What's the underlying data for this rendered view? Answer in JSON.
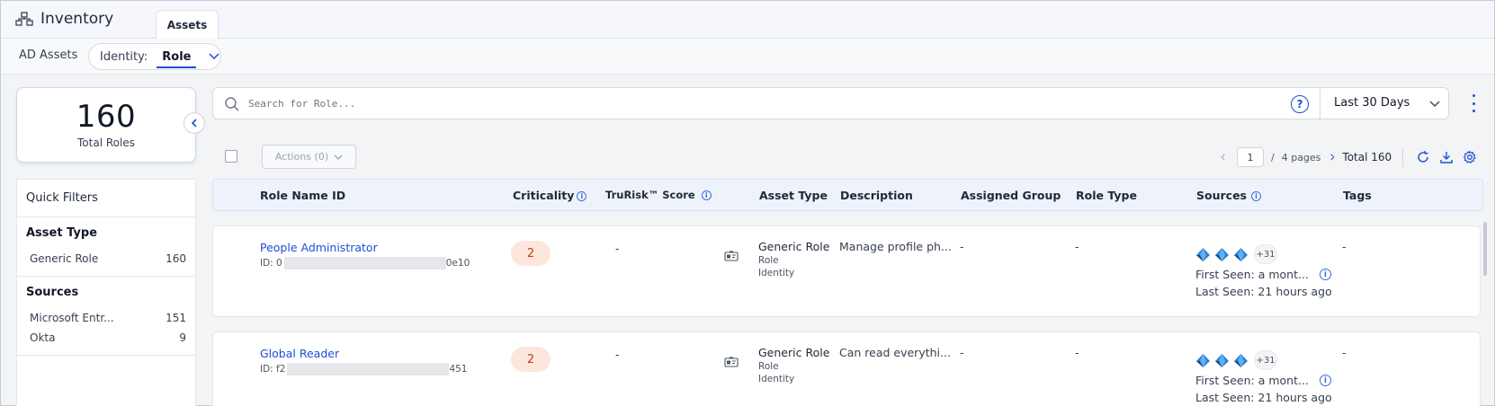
{
  "header": {
    "app_title": "Inventory",
    "tabs": [
      {
        "label": "Assets",
        "active": true
      }
    ]
  },
  "subbar": {
    "ad_assets_label": "AD Assets",
    "identity_label": "Identity:",
    "identity_value": "Role"
  },
  "summary": {
    "count": "160",
    "label": "Total Roles"
  },
  "filters": {
    "title": "Quick Filters",
    "sections": [
      {
        "title": "Asset Type",
        "items": [
          {
            "label": "Generic Role",
            "count": "160"
          }
        ]
      },
      {
        "title": "Sources",
        "items": [
          {
            "label": "Microsoft Entr...",
            "count": "151"
          },
          {
            "label": "Okta",
            "count": "9"
          }
        ]
      }
    ]
  },
  "search": {
    "placeholder": "Search for Role...",
    "help_icon": "?",
    "date_range": "Last 30 Days"
  },
  "toolbar": {
    "actions_label": "Actions (0)",
    "page_current": "1",
    "page_sep": "/",
    "page_total": "4 pages",
    "total_label": "Total 160"
  },
  "table": {
    "columns": [
      {
        "label": "Role Name ID",
        "info": false
      },
      {
        "label": "Criticality",
        "info": true
      },
      {
        "label": "TruRisk™ Score",
        "info": true
      },
      {
        "label": "Asset Type",
        "info": false
      },
      {
        "label": "Description",
        "info": false
      },
      {
        "label": "Assigned Group",
        "info": false
      },
      {
        "label": "Role Type",
        "info": false
      },
      {
        "label": "Sources",
        "info": true
      },
      {
        "label": "Tags",
        "info": false
      }
    ],
    "rows": [
      {
        "name": "People Administrator",
        "id_prefix": "ID: 0",
        "id_suffix": "0e10",
        "criticality": "2",
        "trurisk": "-",
        "asset_type": "Generic Role",
        "asset_sub1": "Role",
        "asset_sub2": "Identity",
        "description": "Manage profile ph...",
        "assigned_group": "-",
        "role_type": "-",
        "sources_more": "+31",
        "first_seen": "First Seen: a mont...",
        "last_seen": "Last Seen: 21 hours ago",
        "tags": "-"
      },
      {
        "name": "Global Reader",
        "id_prefix": "ID: f2",
        "id_suffix": "451",
        "criticality": "2",
        "trurisk": "-",
        "asset_type": "Generic Role",
        "asset_sub1": "Role",
        "asset_sub2": "Identity",
        "description": "Can read everythi...",
        "assigned_group": "-",
        "role_type": "-",
        "sources_more": "+31",
        "first_seen": "First Seen: a mont...",
        "last_seen": "Last Seen: 21 hours ago",
        "tags": "-"
      }
    ]
  },
  "colors": {
    "accent": "#1d4ed8",
    "criticality_bg": "#fde7dd",
    "criticality_text": "#c2410c",
    "header_bg": "#eef3fb"
  },
  "icons": {
    "app": "inventory-hierarchy-icon",
    "identity_chevron": "chevron-down-icon",
    "collapse": "chevron-left-icon",
    "search": "search-icon",
    "help": "help-circle-icon",
    "date_chevron": "chevron-down-icon",
    "more": "kebab-menu-icon",
    "prev": "chevron-left-icon",
    "next": "chevron-right-icon",
    "refresh": "refresh-icon",
    "download": "download-icon",
    "settings": "gear-icon",
    "asset_type": "id-card-icon",
    "source": "azure-entra-icon",
    "info": "info-icon"
  }
}
